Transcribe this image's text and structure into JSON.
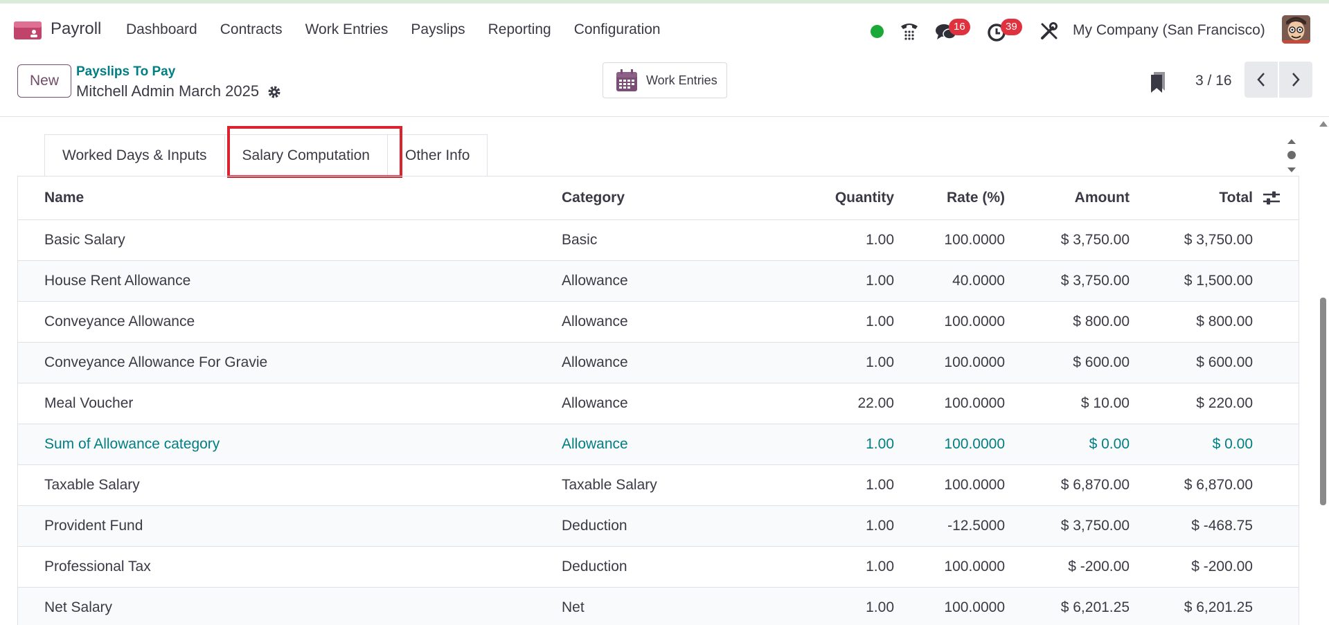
{
  "navbar": {
    "app_name": "Payroll",
    "menu": [
      "Dashboard",
      "Contracts",
      "Work Entries",
      "Payslips",
      "Reporting",
      "Configuration"
    ],
    "chat_badge": "16",
    "activity_badge": "39",
    "company": "My Company (San Francisco)",
    "status_color": "#1aa839"
  },
  "control": {
    "new_label": "New",
    "breadcrumb": "Payslips To Pay",
    "record_title": "Mitchell Admin March 2025",
    "work_entries_label": "Work Entries",
    "pager": "3 / 16"
  },
  "tabs": [
    "Worked Days & Inputs",
    "Salary Computation",
    "Other Info"
  ],
  "active_tab": "Salary Computation",
  "table": {
    "headers": {
      "name": "Name",
      "category": "Category",
      "quantity": "Quantity",
      "rate": "Rate (%)",
      "amount": "Amount",
      "total": "Total"
    },
    "rows": [
      {
        "name": "Basic Salary",
        "category": "Basic",
        "quantity": "1.00",
        "rate": "100.0000",
        "amount": "$ 3,750.00",
        "total": "$ 3,750.00"
      },
      {
        "name": "House Rent Allowance",
        "category": "Allowance",
        "quantity": "1.00",
        "rate": "40.0000",
        "amount": "$ 3,750.00",
        "total": "$ 1,500.00"
      },
      {
        "name": "Conveyance Allowance",
        "category": "Allowance",
        "quantity": "1.00",
        "rate": "100.0000",
        "amount": "$ 800.00",
        "total": "$ 800.00"
      },
      {
        "name": "Conveyance Allowance For Gravie",
        "category": "Allowance",
        "quantity": "1.00",
        "rate": "100.0000",
        "amount": "$ 600.00",
        "total": "$ 600.00"
      },
      {
        "name": "Meal Voucher",
        "category": "Allowance",
        "quantity": "22.00",
        "rate": "100.0000",
        "amount": "$ 10.00",
        "total": "$ 220.00"
      },
      {
        "name": "Sum of Allowance category",
        "category": "Allowance",
        "quantity": "1.00",
        "rate": "100.0000",
        "amount": "$ 0.00",
        "total": "$ 0.00"
      },
      {
        "name": "Taxable Salary",
        "category": "Taxable Salary",
        "quantity": "1.00",
        "rate": "100.0000",
        "amount": "$ 6,870.00",
        "total": "$ 6,870.00"
      },
      {
        "name": "Provident Fund",
        "category": "Deduction",
        "quantity": "1.00",
        "rate": "-12.5000",
        "amount": "$ 3,750.00",
        "total": "$ -468.75"
      },
      {
        "name": "Professional Tax",
        "category": "Deduction",
        "quantity": "1.00",
        "rate": "100.0000",
        "amount": "$ -200.00",
        "total": "$ -200.00"
      },
      {
        "name": "Net Salary",
        "category": "Net",
        "quantity": "1.00",
        "rate": "100.0000",
        "amount": "$ 6,201.25",
        "total": "$ 6,201.25"
      }
    ]
  },
  "colors": {
    "brand": "#714b67",
    "link": "#017e84",
    "highlight": "#d9232f",
    "badge": "#e0323e"
  }
}
